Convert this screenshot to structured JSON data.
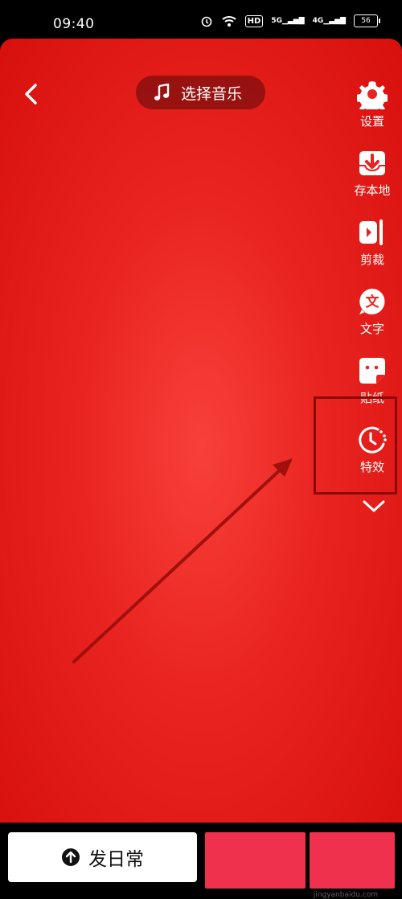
{
  "status_bar": {
    "time": "09:40",
    "hd_label": "HD",
    "net1": "5G",
    "net2": "4G",
    "battery": "56"
  },
  "header": {
    "music_label": "选择音乐"
  },
  "tools": [
    {
      "label": "设置",
      "icon": "gear-icon"
    },
    {
      "label": "存本地",
      "icon": "download-icon"
    },
    {
      "label": "剪裁",
      "icon": "trim-icon"
    },
    {
      "label": "文字",
      "icon": "text-icon"
    },
    {
      "label": "贴纸",
      "icon": "sticker-icon"
    },
    {
      "label": "特效",
      "icon": "effects-icon"
    }
  ],
  "bottom": {
    "post_label": "发日常",
    "watermark": "jingyanbaidu.com"
  },
  "colors": {
    "canvas": "#e9231f",
    "annotation": "#8a0a0a",
    "thumb": "#f0314e"
  }
}
